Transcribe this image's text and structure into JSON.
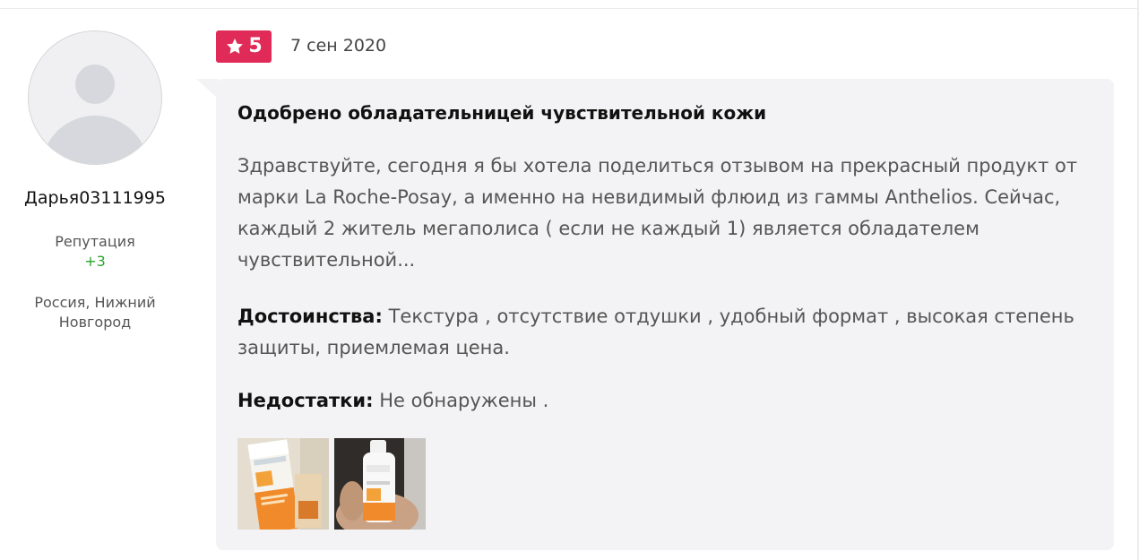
{
  "author": {
    "name": "Дарья03111995",
    "reputation_label": "Репутация",
    "reputation_value": "+3",
    "location": "Россия, Нижний Новгород"
  },
  "review": {
    "rating": "5",
    "date": "7 сен 2020",
    "title": "Одобрено обладательницей чувствительной кожи",
    "body": "Здравствуйте, сегодня я бы хотела поделиться отзывом на прекрасный продукт от марки La Roche-Posay, а именно на невидимый флюид из гаммы Anthelios. Сейчас, каждый 2 житель мегаполиса ( если не каждый 1) является обладателем чувствительной...",
    "pros_label": "Достоинства:",
    "pros_text": "Текстура , отсутствие отдушки , удобный формат , высокая степень защиты, приемлемая цена.",
    "cons_label": "Недостатки:",
    "cons_text": "Не обнаружены .",
    "photo_icons": [
      "product-photo-box",
      "product-photo-bottle-in-hand"
    ]
  },
  "colors": {
    "rating_badge": "#e02a57",
    "card_background": "#f3f3f5",
    "reputation_positive": "#2aa52a"
  }
}
